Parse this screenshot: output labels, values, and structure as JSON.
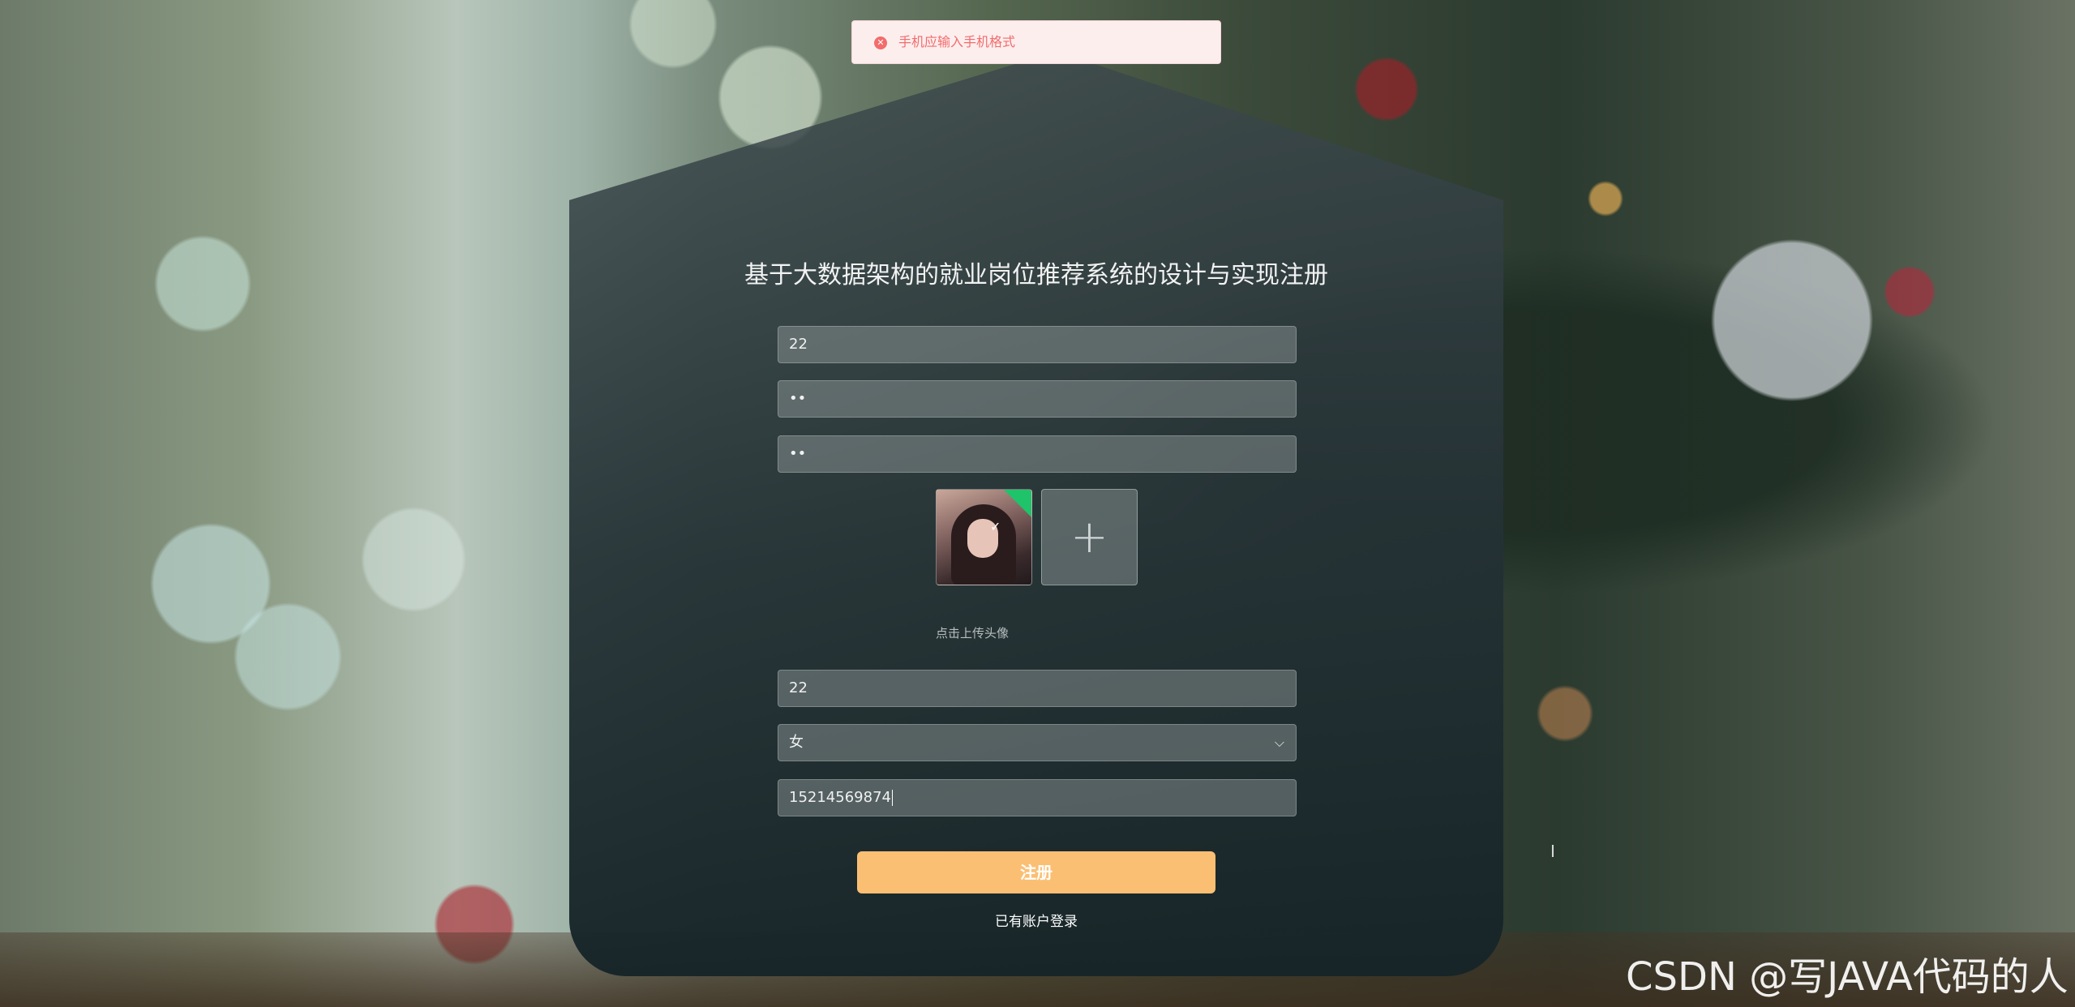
{
  "toast": {
    "icon": "error-circle-icon",
    "message": "手机应输入手机格式",
    "color": "#f26c6c"
  },
  "form": {
    "title": "基于大数据架构的就业岗位推荐系统的设计与实现注册",
    "username": "22",
    "password": "••",
    "confirm_password": "••",
    "avatar_hint": "点击上传头像",
    "age": "22",
    "gender": "女",
    "phone": "15214569874",
    "submit_label": "注册",
    "login_link": "已有账户登录"
  },
  "accent": "#fbbf73",
  "watermark": "CSDN @写JAVA代码的人"
}
